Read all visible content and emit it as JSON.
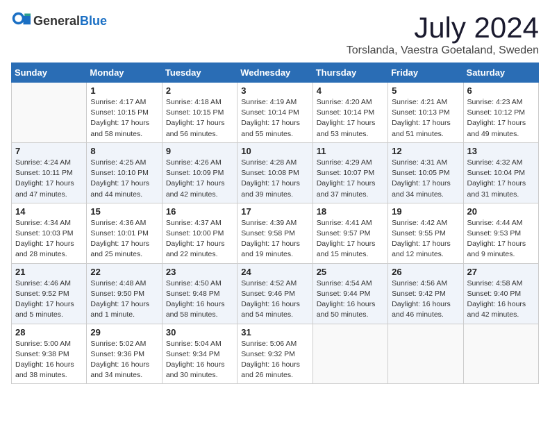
{
  "header": {
    "logo_general": "General",
    "logo_blue": "Blue",
    "month_year": "July 2024",
    "location": "Torslanda, Vaestra Goetaland, Sweden"
  },
  "days_of_week": [
    "Sunday",
    "Monday",
    "Tuesday",
    "Wednesday",
    "Thursday",
    "Friday",
    "Saturday"
  ],
  "weeks": [
    [
      {
        "day": "",
        "info": ""
      },
      {
        "day": "1",
        "info": "Sunrise: 4:17 AM\nSunset: 10:15 PM\nDaylight: 17 hours\nand 58 minutes."
      },
      {
        "day": "2",
        "info": "Sunrise: 4:18 AM\nSunset: 10:15 PM\nDaylight: 17 hours\nand 56 minutes."
      },
      {
        "day": "3",
        "info": "Sunrise: 4:19 AM\nSunset: 10:14 PM\nDaylight: 17 hours\nand 55 minutes."
      },
      {
        "day": "4",
        "info": "Sunrise: 4:20 AM\nSunset: 10:14 PM\nDaylight: 17 hours\nand 53 minutes."
      },
      {
        "day": "5",
        "info": "Sunrise: 4:21 AM\nSunset: 10:13 PM\nDaylight: 17 hours\nand 51 minutes."
      },
      {
        "day": "6",
        "info": "Sunrise: 4:23 AM\nSunset: 10:12 PM\nDaylight: 17 hours\nand 49 minutes."
      }
    ],
    [
      {
        "day": "7",
        "info": "Sunrise: 4:24 AM\nSunset: 10:11 PM\nDaylight: 17 hours\nand 47 minutes."
      },
      {
        "day": "8",
        "info": "Sunrise: 4:25 AM\nSunset: 10:10 PM\nDaylight: 17 hours\nand 44 minutes."
      },
      {
        "day": "9",
        "info": "Sunrise: 4:26 AM\nSunset: 10:09 PM\nDaylight: 17 hours\nand 42 minutes."
      },
      {
        "day": "10",
        "info": "Sunrise: 4:28 AM\nSunset: 10:08 PM\nDaylight: 17 hours\nand 39 minutes."
      },
      {
        "day": "11",
        "info": "Sunrise: 4:29 AM\nSunset: 10:07 PM\nDaylight: 17 hours\nand 37 minutes."
      },
      {
        "day": "12",
        "info": "Sunrise: 4:31 AM\nSunset: 10:05 PM\nDaylight: 17 hours\nand 34 minutes."
      },
      {
        "day": "13",
        "info": "Sunrise: 4:32 AM\nSunset: 10:04 PM\nDaylight: 17 hours\nand 31 minutes."
      }
    ],
    [
      {
        "day": "14",
        "info": "Sunrise: 4:34 AM\nSunset: 10:03 PM\nDaylight: 17 hours\nand 28 minutes."
      },
      {
        "day": "15",
        "info": "Sunrise: 4:36 AM\nSunset: 10:01 PM\nDaylight: 17 hours\nand 25 minutes."
      },
      {
        "day": "16",
        "info": "Sunrise: 4:37 AM\nSunset: 10:00 PM\nDaylight: 17 hours\nand 22 minutes."
      },
      {
        "day": "17",
        "info": "Sunrise: 4:39 AM\nSunset: 9:58 PM\nDaylight: 17 hours\nand 19 minutes."
      },
      {
        "day": "18",
        "info": "Sunrise: 4:41 AM\nSunset: 9:57 PM\nDaylight: 17 hours\nand 15 minutes."
      },
      {
        "day": "19",
        "info": "Sunrise: 4:42 AM\nSunset: 9:55 PM\nDaylight: 17 hours\nand 12 minutes."
      },
      {
        "day": "20",
        "info": "Sunrise: 4:44 AM\nSunset: 9:53 PM\nDaylight: 17 hours\nand 9 minutes."
      }
    ],
    [
      {
        "day": "21",
        "info": "Sunrise: 4:46 AM\nSunset: 9:52 PM\nDaylight: 17 hours\nand 5 minutes."
      },
      {
        "day": "22",
        "info": "Sunrise: 4:48 AM\nSunset: 9:50 PM\nDaylight: 17 hours\nand 1 minute."
      },
      {
        "day": "23",
        "info": "Sunrise: 4:50 AM\nSunset: 9:48 PM\nDaylight: 16 hours\nand 58 minutes."
      },
      {
        "day": "24",
        "info": "Sunrise: 4:52 AM\nSunset: 9:46 PM\nDaylight: 16 hours\nand 54 minutes."
      },
      {
        "day": "25",
        "info": "Sunrise: 4:54 AM\nSunset: 9:44 PM\nDaylight: 16 hours\nand 50 minutes."
      },
      {
        "day": "26",
        "info": "Sunrise: 4:56 AM\nSunset: 9:42 PM\nDaylight: 16 hours\nand 46 minutes."
      },
      {
        "day": "27",
        "info": "Sunrise: 4:58 AM\nSunset: 9:40 PM\nDaylight: 16 hours\nand 42 minutes."
      }
    ],
    [
      {
        "day": "28",
        "info": "Sunrise: 5:00 AM\nSunset: 9:38 PM\nDaylight: 16 hours\nand 38 minutes."
      },
      {
        "day": "29",
        "info": "Sunrise: 5:02 AM\nSunset: 9:36 PM\nDaylight: 16 hours\nand 34 minutes."
      },
      {
        "day": "30",
        "info": "Sunrise: 5:04 AM\nSunset: 9:34 PM\nDaylight: 16 hours\nand 30 minutes."
      },
      {
        "day": "31",
        "info": "Sunrise: 5:06 AM\nSunset: 9:32 PM\nDaylight: 16 hours\nand 26 minutes."
      },
      {
        "day": "",
        "info": ""
      },
      {
        "day": "",
        "info": ""
      },
      {
        "day": "",
        "info": ""
      }
    ]
  ]
}
